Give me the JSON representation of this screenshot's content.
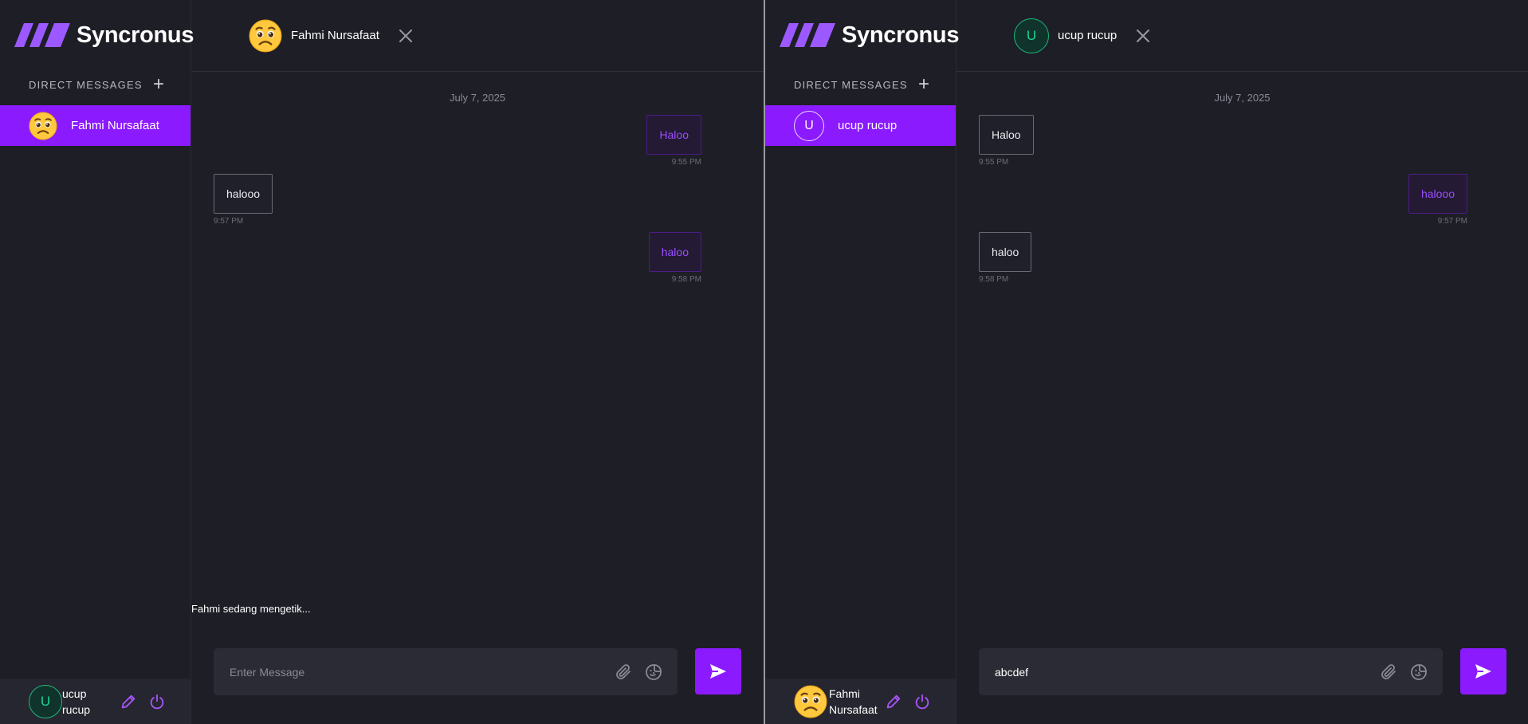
{
  "colors": {
    "accent": "#8c1aff",
    "background": "#1e1e27",
    "sidebar_footer": "#262630",
    "composer": "#2b2b35",
    "outgoing_text": "#9b4dff",
    "avatar_green": "#1fd393"
  },
  "left": {
    "brand": {
      "name": "Syncronus",
      "logo_icon": "slash-stripes-logo"
    },
    "direct_messages": {
      "title": "DIRECT MESSAGES",
      "add_icon": "plus-icon"
    },
    "contacts": [
      {
        "name": "Fahmi Nursafaat",
        "avatar": "worried-face-emoji",
        "active": true
      }
    ],
    "current_user": {
      "avatar_letter": "U",
      "name_line1": "ucup",
      "name_line2": "rucup",
      "edit_icon": "pencil-icon",
      "logout_icon": "power-icon"
    },
    "chat": {
      "header": {
        "name": "Fahmi Nursafaat",
        "avatar": "worried-face-emoji",
        "close_icon": "close-icon"
      },
      "date": "July 7, 2025",
      "messages": [
        {
          "text": "Haloo",
          "time": "9:55 PM",
          "direction": "outgoing"
        },
        {
          "text": "halooo",
          "time": "9:57 PM",
          "direction": "incoming"
        },
        {
          "text": "haloo",
          "time": "9:58 PM",
          "direction": "outgoing"
        }
      ],
      "typing_indicator": "Fahmi sedang mengetik...",
      "composer": {
        "value": "",
        "placeholder": "Enter Message",
        "attach_icon": "paperclip-icon",
        "sticker_icon": "sticker-icon",
        "send_icon": "send-icon"
      }
    }
  },
  "right": {
    "brand": {
      "name": "Syncronus",
      "logo_icon": "slash-stripes-logo"
    },
    "direct_messages": {
      "title": "DIRECT MESSAGES",
      "add_icon": "plus-icon"
    },
    "contacts": [
      {
        "name": "ucup rucup",
        "avatar_letter": "U",
        "active": true
      }
    ],
    "current_user": {
      "avatar": "worried-face-emoji",
      "name_line1": "Fahmi",
      "name_line2": "Nursafaat",
      "edit_icon": "pencil-icon",
      "logout_icon": "power-icon"
    },
    "chat": {
      "header": {
        "name": "ucup rucup",
        "avatar_letter": "U",
        "close_icon": "close-icon"
      },
      "date": "July 7, 2025",
      "messages": [
        {
          "text": "Haloo",
          "time": "9:55 PM",
          "direction": "incoming"
        },
        {
          "text": "halooo",
          "time": "9:57 PM",
          "direction": "outgoing"
        },
        {
          "text": "haloo",
          "time": "9:58 PM",
          "direction": "incoming"
        }
      ],
      "composer": {
        "value": "abcdef",
        "placeholder": "Enter Message",
        "attach_icon": "paperclip-icon",
        "sticker_icon": "sticker-icon",
        "send_icon": "send-icon"
      }
    }
  }
}
